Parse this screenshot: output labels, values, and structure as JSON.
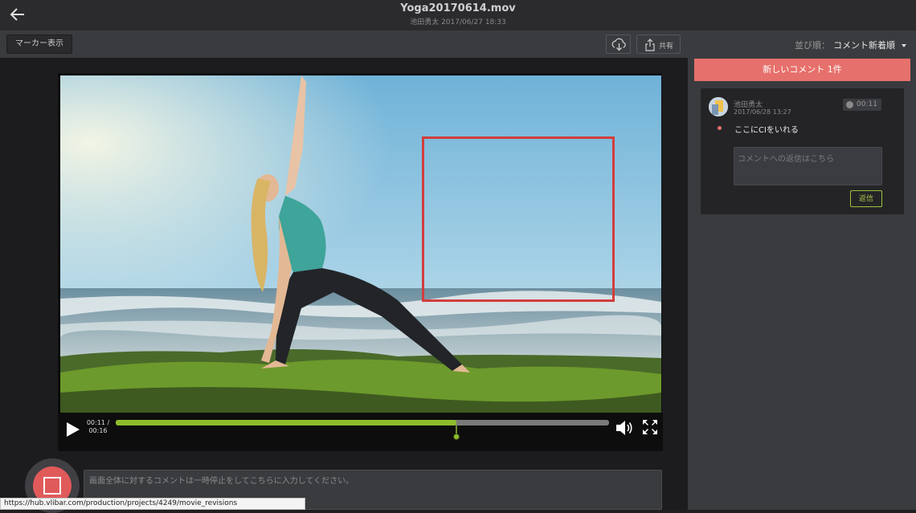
{
  "header": {
    "title": "Yoga20170614.mov",
    "subtitle": "池田勇太 2017/06/27 18:33"
  },
  "toolbar": {
    "marker_label": "マーカー表示",
    "share_label": "共有"
  },
  "player": {
    "current_time": "00:11 /",
    "duration": "00:16",
    "progress": 0.69,
    "marker_position": 0.69
  },
  "comment_input": {
    "placeholder": "画面全体に対するコメントは一時停止をしてこちらに入力してください。"
  },
  "status_bar": {
    "url": "https://hub.vlibar.com/production/projects/4249/movie_revisions"
  },
  "sidebar": {
    "sort_label": "並び順：",
    "sort_value": "コメント新着順",
    "new_banner": "新しいコメント 1件",
    "comment": {
      "author": "池田勇太",
      "date": "2017/06/28 13:27",
      "timestamp": "00:11",
      "text": "ここにCIをいれる",
      "reply_placeholder": "コメントへの返信はこちら",
      "reply_button": "返信"
    }
  },
  "colors": {
    "accent_red": "#e6706b",
    "progress_green": "#8dbd2a",
    "marker_red": "#d33d3d"
  }
}
